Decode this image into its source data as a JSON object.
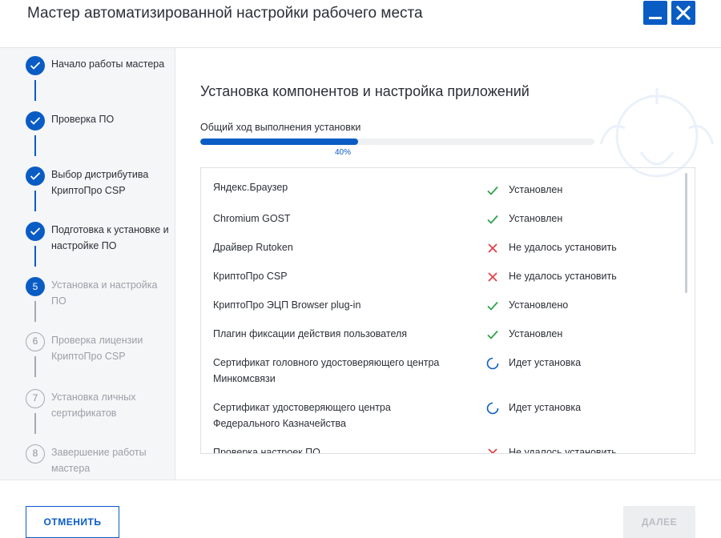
{
  "window": {
    "title": "Мастер автоматизированной настройки рабочего места",
    "minimize_icon": "minimize-icon",
    "close_icon": "close-icon",
    "accent_color": "#0a5cc5"
  },
  "steps": [
    {
      "label": "Начало работы мастера",
      "state": "done"
    },
    {
      "label": "Проверка ПО",
      "state": "done"
    },
    {
      "label": "Выбор дистрибутива КриптоПро CSP",
      "state": "done"
    },
    {
      "label": "Подготовка к установке и настройке ПО",
      "state": "done"
    },
    {
      "label": "Установка и настройка ПО",
      "state": "current",
      "number": "5"
    },
    {
      "label": "Проверка лицензии КриптоПро CSP",
      "state": "pending",
      "number": "6"
    },
    {
      "label": "Установка личных сертификатов",
      "state": "pending",
      "number": "7"
    },
    {
      "label": "Завершение работы мастера",
      "state": "pending",
      "number": "8"
    }
  ],
  "main": {
    "title": "Установка компонентов и настройка приложений",
    "progress_label": "Общий ход выполнения установки",
    "progress_percent": "40%",
    "progress_value": 0.4
  },
  "components": [
    {
      "name": "Яндекс.Браузер",
      "status": "Установлен",
      "icon": "check-icon"
    },
    {
      "name": "Chromium GOST",
      "status": "Установлен",
      "icon": "check-icon"
    },
    {
      "name": "Драйвер Rutoken",
      "status": "Не удалось установить",
      "icon": "cross-icon"
    },
    {
      "name": "КриптоПро CSP",
      "status": "Не удалось установить",
      "icon": "cross-icon"
    },
    {
      "name": "КриптоПро ЭЦП Browser plug-in",
      "status": "Установлено",
      "icon": "check-icon"
    },
    {
      "name": "Плагин фиксации действия пользователя",
      "status": "Установлен",
      "icon": "check-icon"
    },
    {
      "name": "Сертификат головного удостоверяющего центра Минкомсвязи",
      "status": "Идет установка",
      "icon": "spinner-icon"
    },
    {
      "name": "Сертификат удостоверяющего центра Федерального Казначейства",
      "status": "Идет установка",
      "icon": "spinner-icon"
    },
    {
      "name": "Проверка настроек ПО",
      "status": "Не удалось установить",
      "icon": "cross-icon"
    }
  ],
  "footer": {
    "cancel_label": "ОТМЕНИТЬ",
    "next_label": "ДАЛЕЕ"
  }
}
